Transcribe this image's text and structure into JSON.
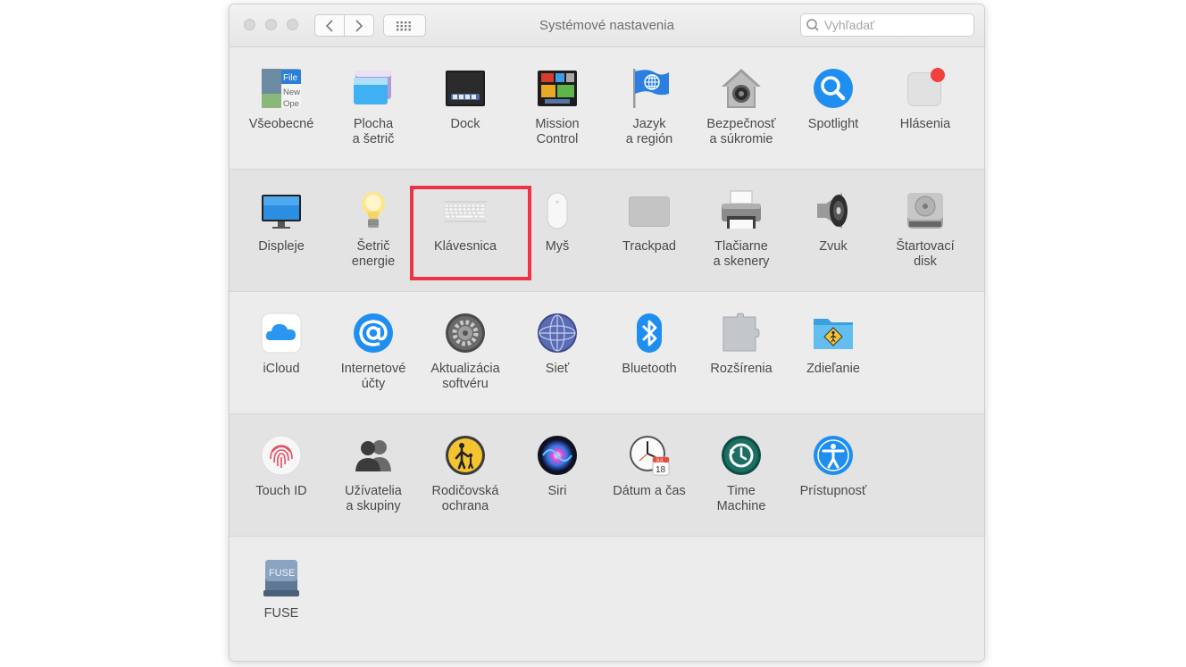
{
  "window": {
    "title": "Systémové nastavenia"
  },
  "search": {
    "placeholder": "Vyhľadať"
  },
  "rows": [
    [
      {
        "id": "general",
        "label": "Všeobecné",
        "icon": "general-icon"
      },
      {
        "id": "desktop",
        "label": "Plocha\na šetrič",
        "icon": "desktop-screensaver-icon"
      },
      {
        "id": "dock",
        "label": "Dock",
        "icon": "dock-icon"
      },
      {
        "id": "mission",
        "label": "Mission\nControl",
        "icon": "mission-control-icon"
      },
      {
        "id": "language",
        "label": "Jazyk\na región",
        "icon": "language-region-icon"
      },
      {
        "id": "security",
        "label": "Bezpečnosť\na súkromie",
        "icon": "security-privacy-icon"
      },
      {
        "id": "spotlight",
        "label": "Spotlight",
        "icon": "spotlight-icon"
      },
      {
        "id": "notifications",
        "label": "Hlásenia",
        "icon": "notifications-icon"
      }
    ],
    [
      {
        "id": "displays",
        "label": "Displeje",
        "icon": "displays-icon"
      },
      {
        "id": "energy",
        "label": "Šetrič\nenergie",
        "icon": "energy-saver-icon"
      },
      {
        "id": "keyboard",
        "label": "Klávesnica",
        "icon": "keyboard-icon"
      },
      {
        "id": "mouse",
        "label": "Myš",
        "icon": "mouse-icon"
      },
      {
        "id": "trackpad",
        "label": "Trackpad",
        "icon": "trackpad-icon"
      },
      {
        "id": "printers",
        "label": "Tlačiarne\na skenery",
        "icon": "printers-scanners-icon"
      },
      {
        "id": "sound",
        "label": "Zvuk",
        "icon": "sound-icon"
      },
      {
        "id": "startup",
        "label": "Štartovací\ndisk",
        "icon": "startup-disk-icon"
      }
    ],
    [
      {
        "id": "icloud",
        "label": "iCloud",
        "icon": "icloud-icon"
      },
      {
        "id": "internet",
        "label": "Internetové\núčty",
        "icon": "internet-accounts-icon"
      },
      {
        "id": "update",
        "label": "Aktualizácia\nsoftvéru",
        "icon": "software-update-icon"
      },
      {
        "id": "network",
        "label": "Sieť",
        "icon": "network-icon"
      },
      {
        "id": "bluetooth",
        "label": "Bluetooth",
        "icon": "bluetooth-icon"
      },
      {
        "id": "extensions",
        "label": "Rozšírenia",
        "icon": "extensions-icon"
      },
      {
        "id": "sharing",
        "label": "Zdieľanie",
        "icon": "sharing-icon"
      }
    ],
    [
      {
        "id": "touchid",
        "label": "Touch ID",
        "icon": "touch-id-icon"
      },
      {
        "id": "users",
        "label": "Užívatelia\na skupiny",
        "icon": "users-groups-icon"
      },
      {
        "id": "parental",
        "label": "Rodičovská\nochrana",
        "icon": "parental-controls-icon"
      },
      {
        "id": "siri",
        "label": "Siri",
        "icon": "siri-icon"
      },
      {
        "id": "datetime",
        "label": "Dátum a čas",
        "icon": "date-time-icon"
      },
      {
        "id": "timemachine",
        "label": "Time\nMachine",
        "icon": "time-machine-icon"
      },
      {
        "id": "accessibility",
        "label": "Prístupnosť",
        "icon": "accessibility-icon"
      }
    ],
    [
      {
        "id": "fuse",
        "label": "FUSE",
        "icon": "fuse-icon"
      }
    ]
  ],
  "icon_text": {
    "general": [
      "File",
      "New",
      "Ope"
    ],
    "calendar_month": "JUL",
    "calendar_day": "18",
    "fuse": "FUSE"
  },
  "highlight": {
    "item": "keyboard",
    "color": "#ee3347"
  },
  "colors": {
    "accent_blue": "#1f8ef1",
    "badge_red": "#f0413d",
    "time_machine_green": "#1c6f62"
  }
}
